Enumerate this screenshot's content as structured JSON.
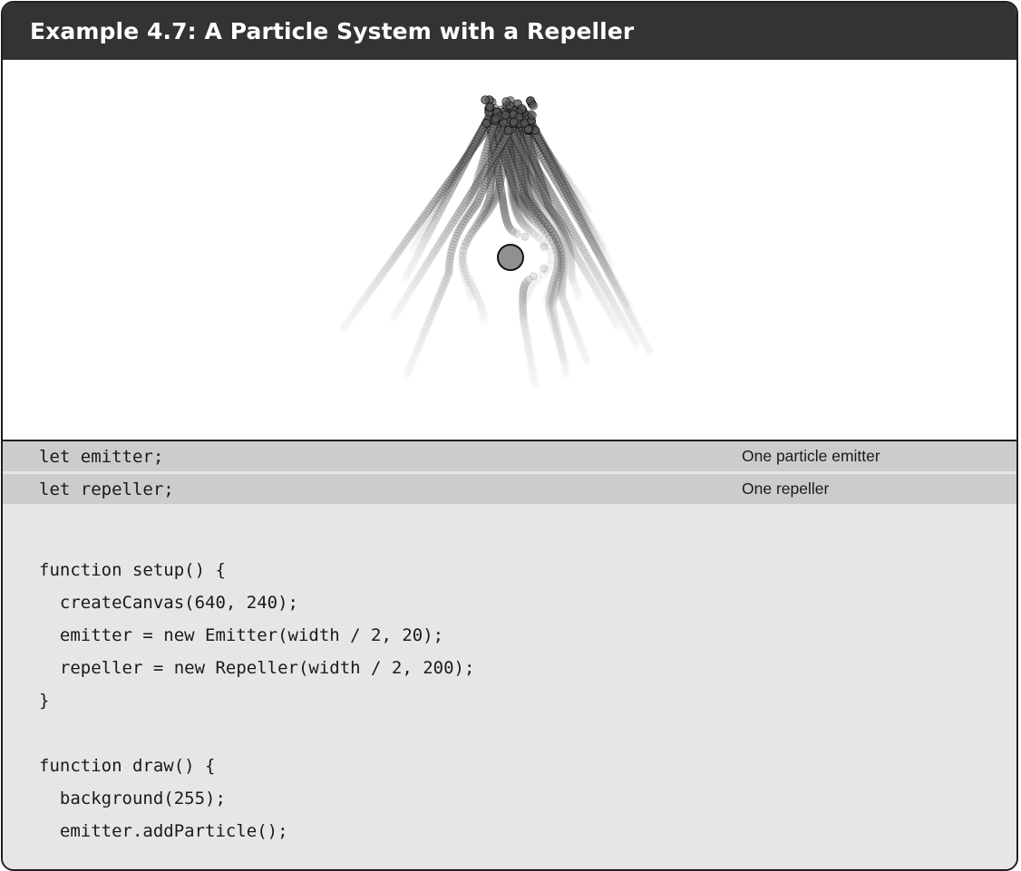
{
  "header": {
    "title": "Example 4.7: A Particle System with a Repeller"
  },
  "colors": {
    "header_bg": "#333333",
    "highlight_bg": "#cccccc",
    "code_bg": "#e6e6e6",
    "repeller_fill": "#909090"
  },
  "code": {
    "lines": [
      {
        "text": "let emitter;",
        "note": "One particle emitter",
        "highlighted": true
      },
      {
        "text": "let repeller;",
        "note": "One repeller",
        "highlighted": true
      },
      {
        "text": "",
        "note": "",
        "highlighted": false
      },
      {
        "text": "function setup() {",
        "note": "",
        "highlighted": false
      },
      {
        "text": "  createCanvas(640, 240);",
        "note": "",
        "highlighted": false
      },
      {
        "text": "  emitter = new Emitter(width / 2, 20);",
        "note": "",
        "highlighted": false
      },
      {
        "text": "  repeller = new Repeller(width / 2, 200);",
        "note": "",
        "highlighted": false
      },
      {
        "text": "}",
        "note": "",
        "highlighted": false
      },
      {
        "text": "",
        "note": "",
        "highlighted": false
      },
      {
        "text": "function draw() {",
        "note": "",
        "highlighted": false
      },
      {
        "text": "  background(255);",
        "note": "",
        "highlighted": false
      },
      {
        "text": "  emitter.addParticle();",
        "note": "",
        "highlighted": false
      }
    ]
  }
}
